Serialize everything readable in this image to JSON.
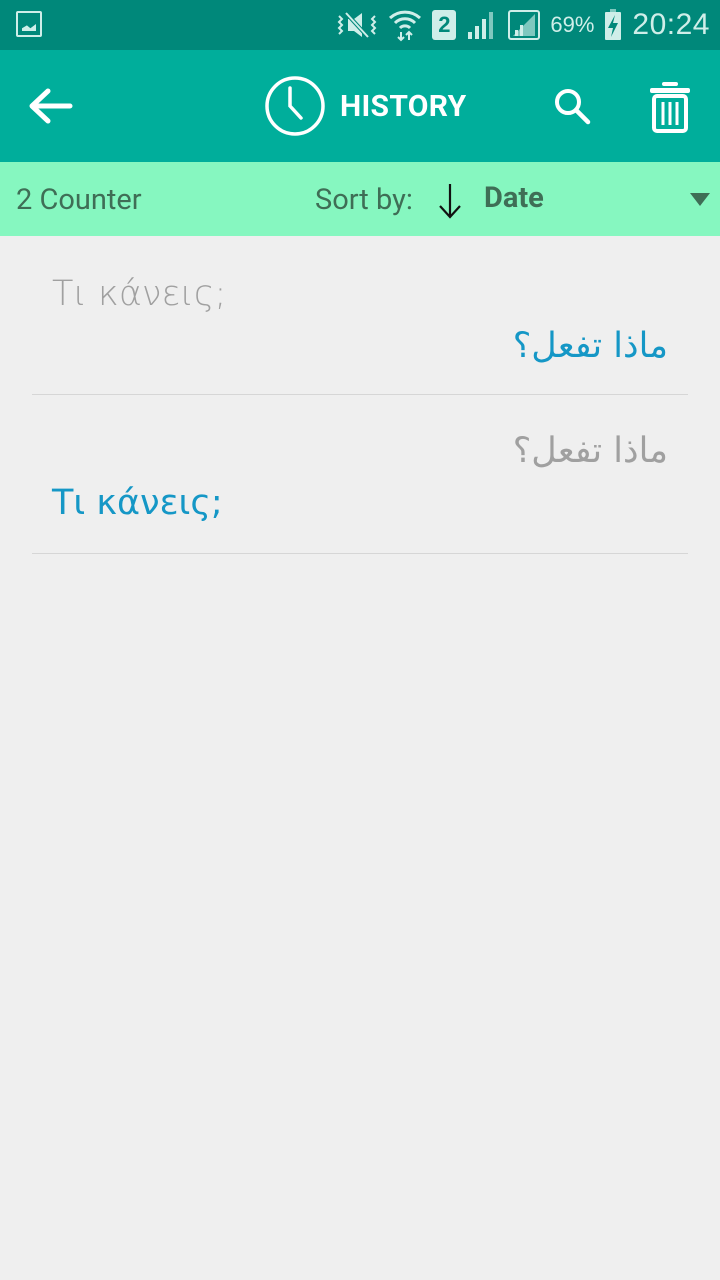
{
  "status_bar": {
    "battery_percent": "69%",
    "time": "20:24",
    "sim_slot": "2",
    "icons": [
      "gallery-icon",
      "mute-vibrate-icon",
      "wifi-icon",
      "sim-icon",
      "signal-icon",
      "signal-icon",
      "battery-charging-icon"
    ]
  },
  "app_bar": {
    "title": "HISTORY",
    "back_icon": "arrow-left-icon",
    "title_icon": "clock-icon",
    "search_icon": "search-icon",
    "delete_icon": "trash-icon",
    "color": "#00ae9b"
  },
  "sort_bar": {
    "counter": "2 Counter",
    "sort_label": "Sort by:",
    "sort_direction": "descending",
    "sort_value": "Date",
    "color": "#86f7c0"
  },
  "history": [
    {
      "source": "Τι κάνεις;",
      "translation": "ماذا تفعل؟",
      "source_side": "left",
      "translation_side": "right"
    },
    {
      "source": "ماذا تفعل؟",
      "translation": "Τι κάνεις;",
      "source_side": "right",
      "translation_side": "left"
    }
  ],
  "colors": {
    "source_text": "#a0a0a0",
    "translation_text": "#1597c6",
    "background": "#efefef"
  }
}
